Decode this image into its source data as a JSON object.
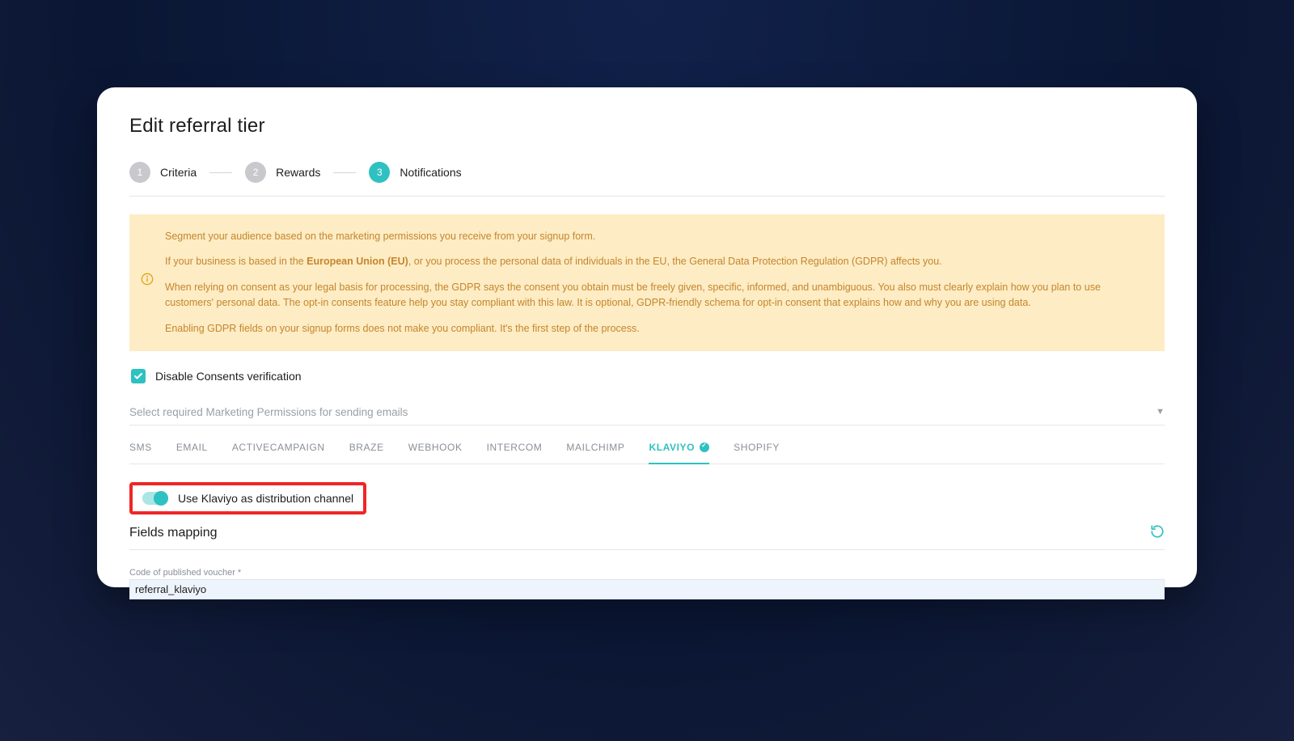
{
  "page": {
    "title": "Edit referral tier"
  },
  "stepper": {
    "steps": [
      {
        "num": "1",
        "label": "Criteria",
        "active": false
      },
      {
        "num": "2",
        "label": "Rewards",
        "active": false
      },
      {
        "num": "3",
        "label": "Notifications",
        "active": true
      }
    ]
  },
  "notice": {
    "p1": "Segment your audience based on the marketing permissions you receive from your signup form.",
    "p2_prefix": "If your business is based in the ",
    "p2_bold": "European Union (EU)",
    "p2_suffix": ", or you process the personal data of individuals in the EU, the General Data Protection Regulation (GDPR) affects you.",
    "p3": "When relying on consent as your legal basis for processing, the GDPR says the consent you obtain must be freely given, specific, informed, and unambiguous. You also must clearly explain how you plan to use customers' personal data. The opt-in consents feature help you stay compliant with this law. It is optional, GDPR-friendly schema for opt-in consent that explains how and why you are using data.",
    "p4": "Enabling GDPR fields on your signup forms does not make you compliant. It's the first step of the process."
  },
  "consents": {
    "disable_label": "Disable Consents verification",
    "checked": true
  },
  "permissions_select": {
    "placeholder": "Select required Marketing Permissions for sending emails"
  },
  "tabs": [
    {
      "label": "SMS",
      "active": false,
      "badge": false
    },
    {
      "label": "EMAIL",
      "active": false,
      "badge": false
    },
    {
      "label": "ACTIVECAMPAIGN",
      "active": false,
      "badge": false
    },
    {
      "label": "BRAZE",
      "active": false,
      "badge": false
    },
    {
      "label": "WEBHOOK",
      "active": false,
      "badge": false
    },
    {
      "label": "INTERCOM",
      "active": false,
      "badge": false
    },
    {
      "label": "MAILCHIMP",
      "active": false,
      "badge": false
    },
    {
      "label": "KLAVIYO",
      "active": true,
      "badge": true
    },
    {
      "label": "SHOPIFY",
      "active": false,
      "badge": false
    }
  ],
  "klaviyo": {
    "toggle_label": "Use Klaviyo as distribution channel",
    "toggle_on": true
  },
  "fields_mapping": {
    "title": "Fields mapping",
    "voucher_label": "Code of published voucher *",
    "voucher_value": "referral_klaviyo"
  }
}
